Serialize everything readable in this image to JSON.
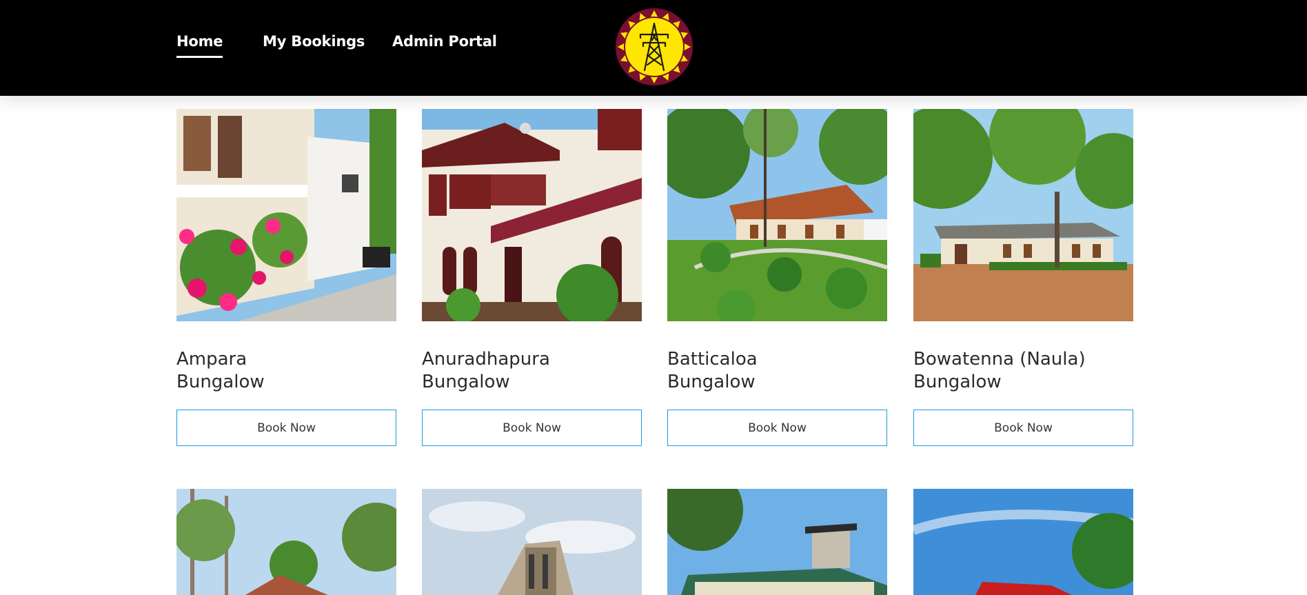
{
  "nav": {
    "home": "Home",
    "bookings": "My Bookings",
    "admin": "Admin Portal"
  },
  "logo_icon": "power-transmission-tower-sun-logo",
  "colors": {
    "header_bg": "#000000",
    "button_border": "#1a9be0",
    "logo_yellow": "#ffe600",
    "logo_maroon": "#7a0f2e"
  },
  "bungalows": [
    {
      "name_line1": "Ampara",
      "name_line2": "Bungalow",
      "button": "Book Now"
    },
    {
      "name_line1": "Anuradhapura",
      "name_line2": "Bungalow",
      "button": "Book Now"
    },
    {
      "name_line1": "Batticaloa",
      "name_line2": "Bungalow",
      "button": "Book Now"
    },
    {
      "name_line1": "Bowatenna (Naula)",
      "name_line2": "Bungalow",
      "button": "Book Now"
    }
  ]
}
